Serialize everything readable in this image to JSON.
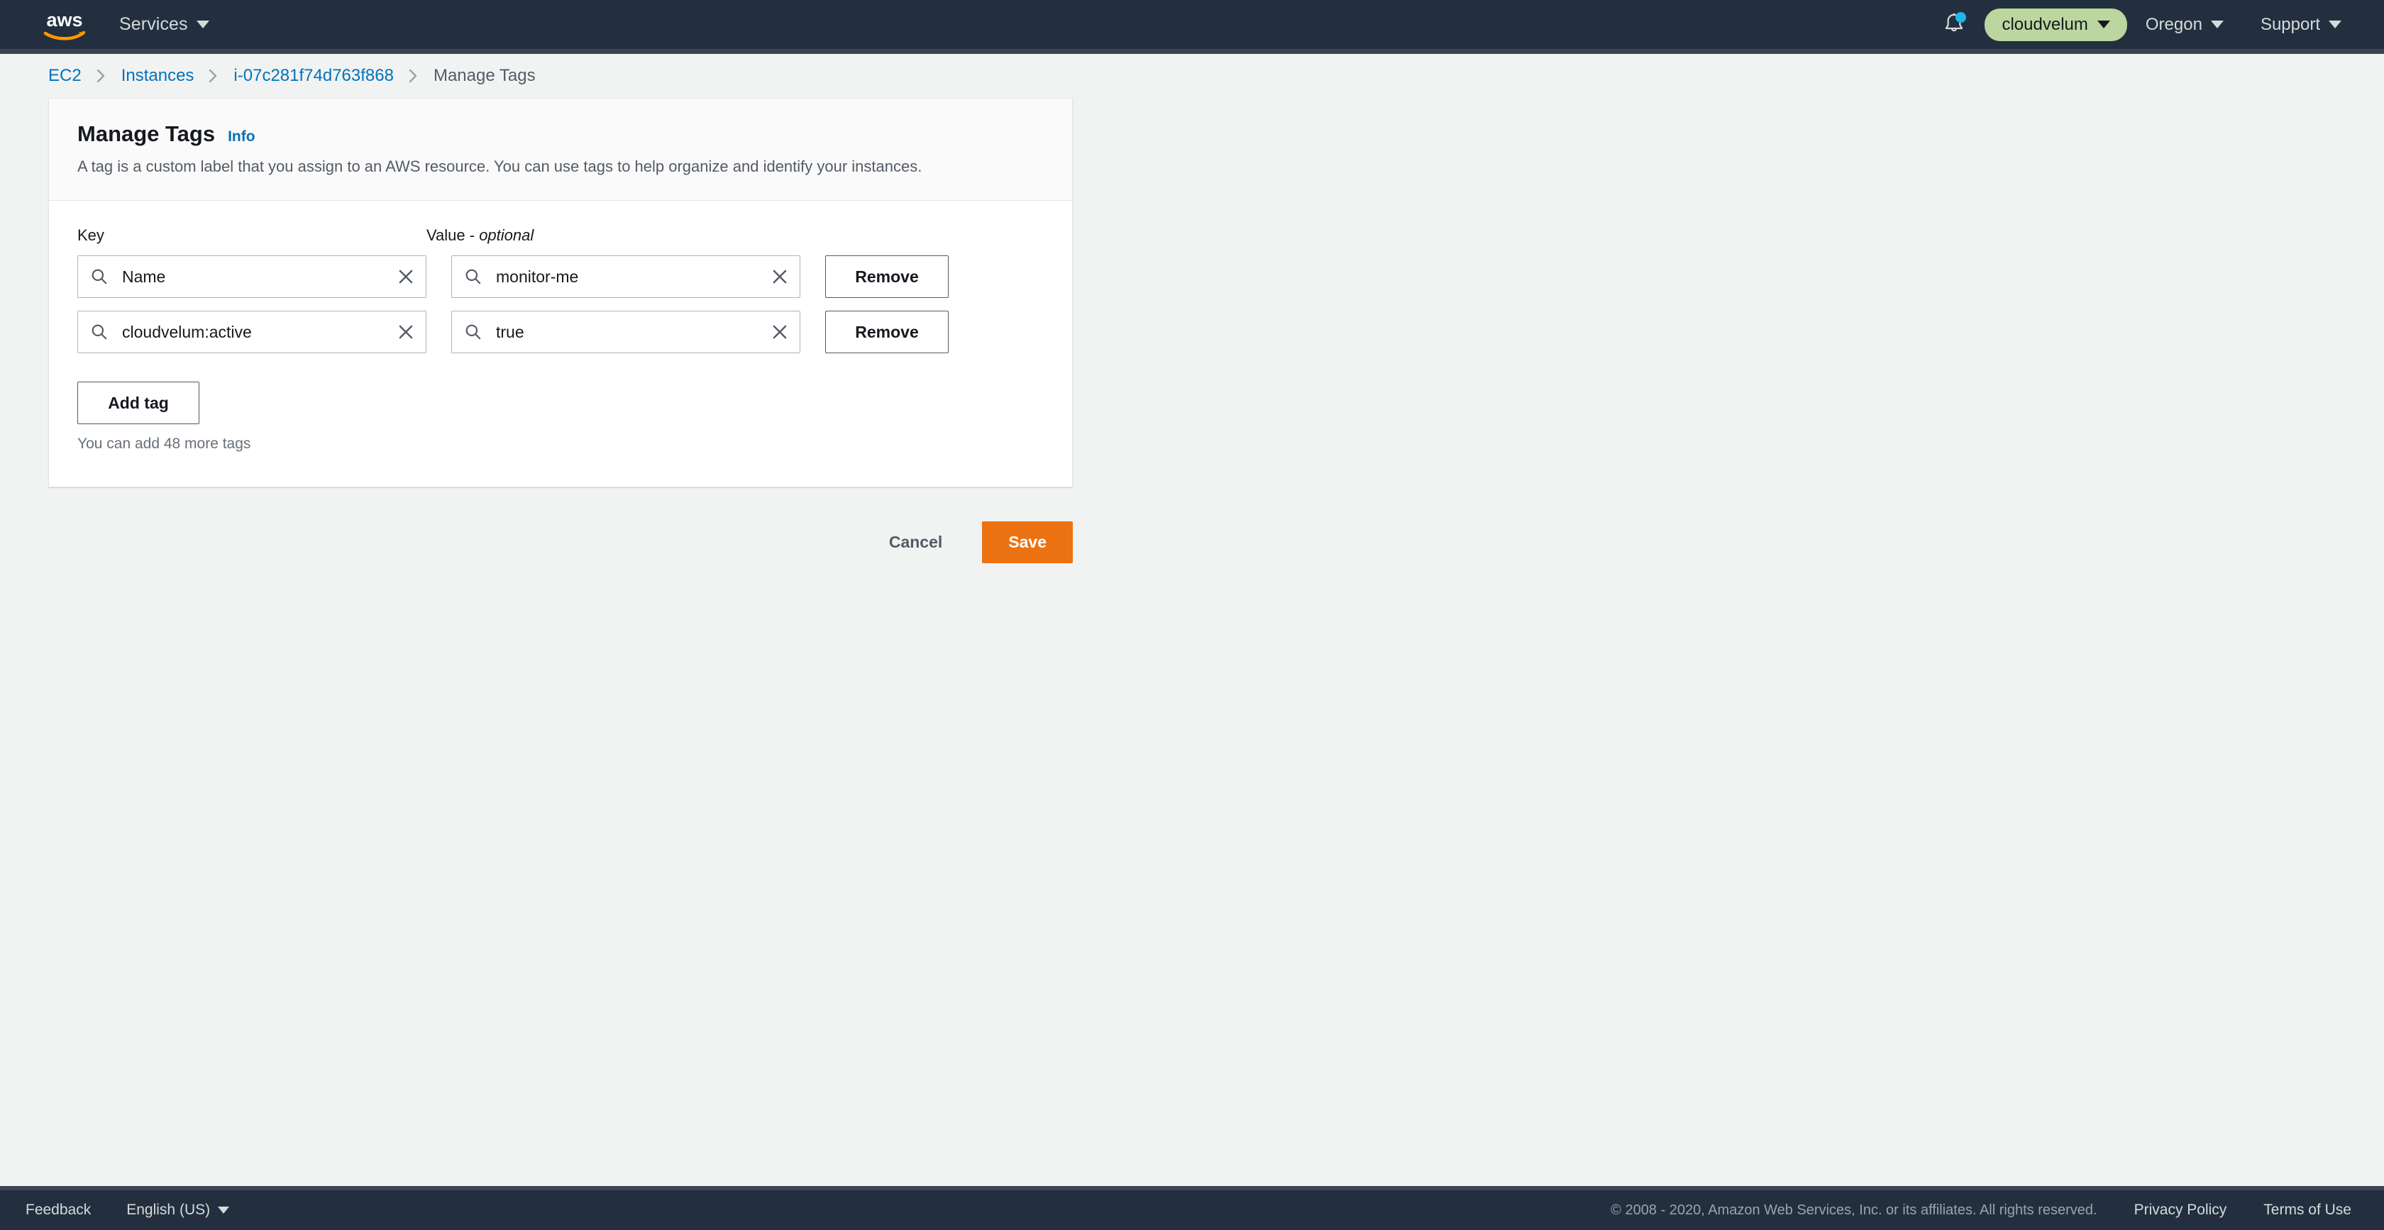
{
  "topnav": {
    "logo_alt": "aws",
    "services_label": "Services",
    "notifications_icon": "bell-icon",
    "account_label": "cloudvelum",
    "region_label": "Oregon",
    "support_label": "Support"
  },
  "breadcrumb": {
    "items": [
      {
        "label": "EC2",
        "current": false
      },
      {
        "label": "Instances",
        "current": false
      },
      {
        "label": "i-07c281f74d763f868",
        "current": false
      },
      {
        "label": "Manage Tags",
        "current": true
      }
    ]
  },
  "card": {
    "title": "Manage Tags",
    "info_label": "Info",
    "description": "A tag is a custom label that you assign to an AWS resource. You can use tags to help organize and identify your instances.",
    "key_label": "Key",
    "value_label_prefix": "Value - ",
    "value_label_optional": "optional",
    "rows": [
      {
        "key": "Name",
        "value": "monitor-me",
        "remove_label": "Remove",
        "key_placeholder": "",
        "value_placeholder": ""
      },
      {
        "key": "cloudvelum:active",
        "value": "true",
        "remove_label": "Remove",
        "key_placeholder": "",
        "value_placeholder": ""
      }
    ],
    "add_tag_label": "Add tag",
    "helper_text": "You can add 48 more tags"
  },
  "actions": {
    "cancel_label": "Cancel",
    "save_label": "Save"
  },
  "footer": {
    "feedback_label": "Feedback",
    "language_label": "English (US)",
    "copyright": "© 2008 - 2020, Amazon Web Services, Inc. or its affiliates. All rights reserved.",
    "privacy_label": "Privacy Policy",
    "terms_label": "Terms of Use"
  },
  "colors": {
    "nav_background": "#232f3e",
    "page_background": "#f1f3f3",
    "accent_orange": "#ec7211",
    "link_blue": "#0073bb",
    "account_pill": "#bcd6a0",
    "notification_dot": "#1eb7e8",
    "input_border": "#aab7b8",
    "button_border": "#545b64"
  }
}
